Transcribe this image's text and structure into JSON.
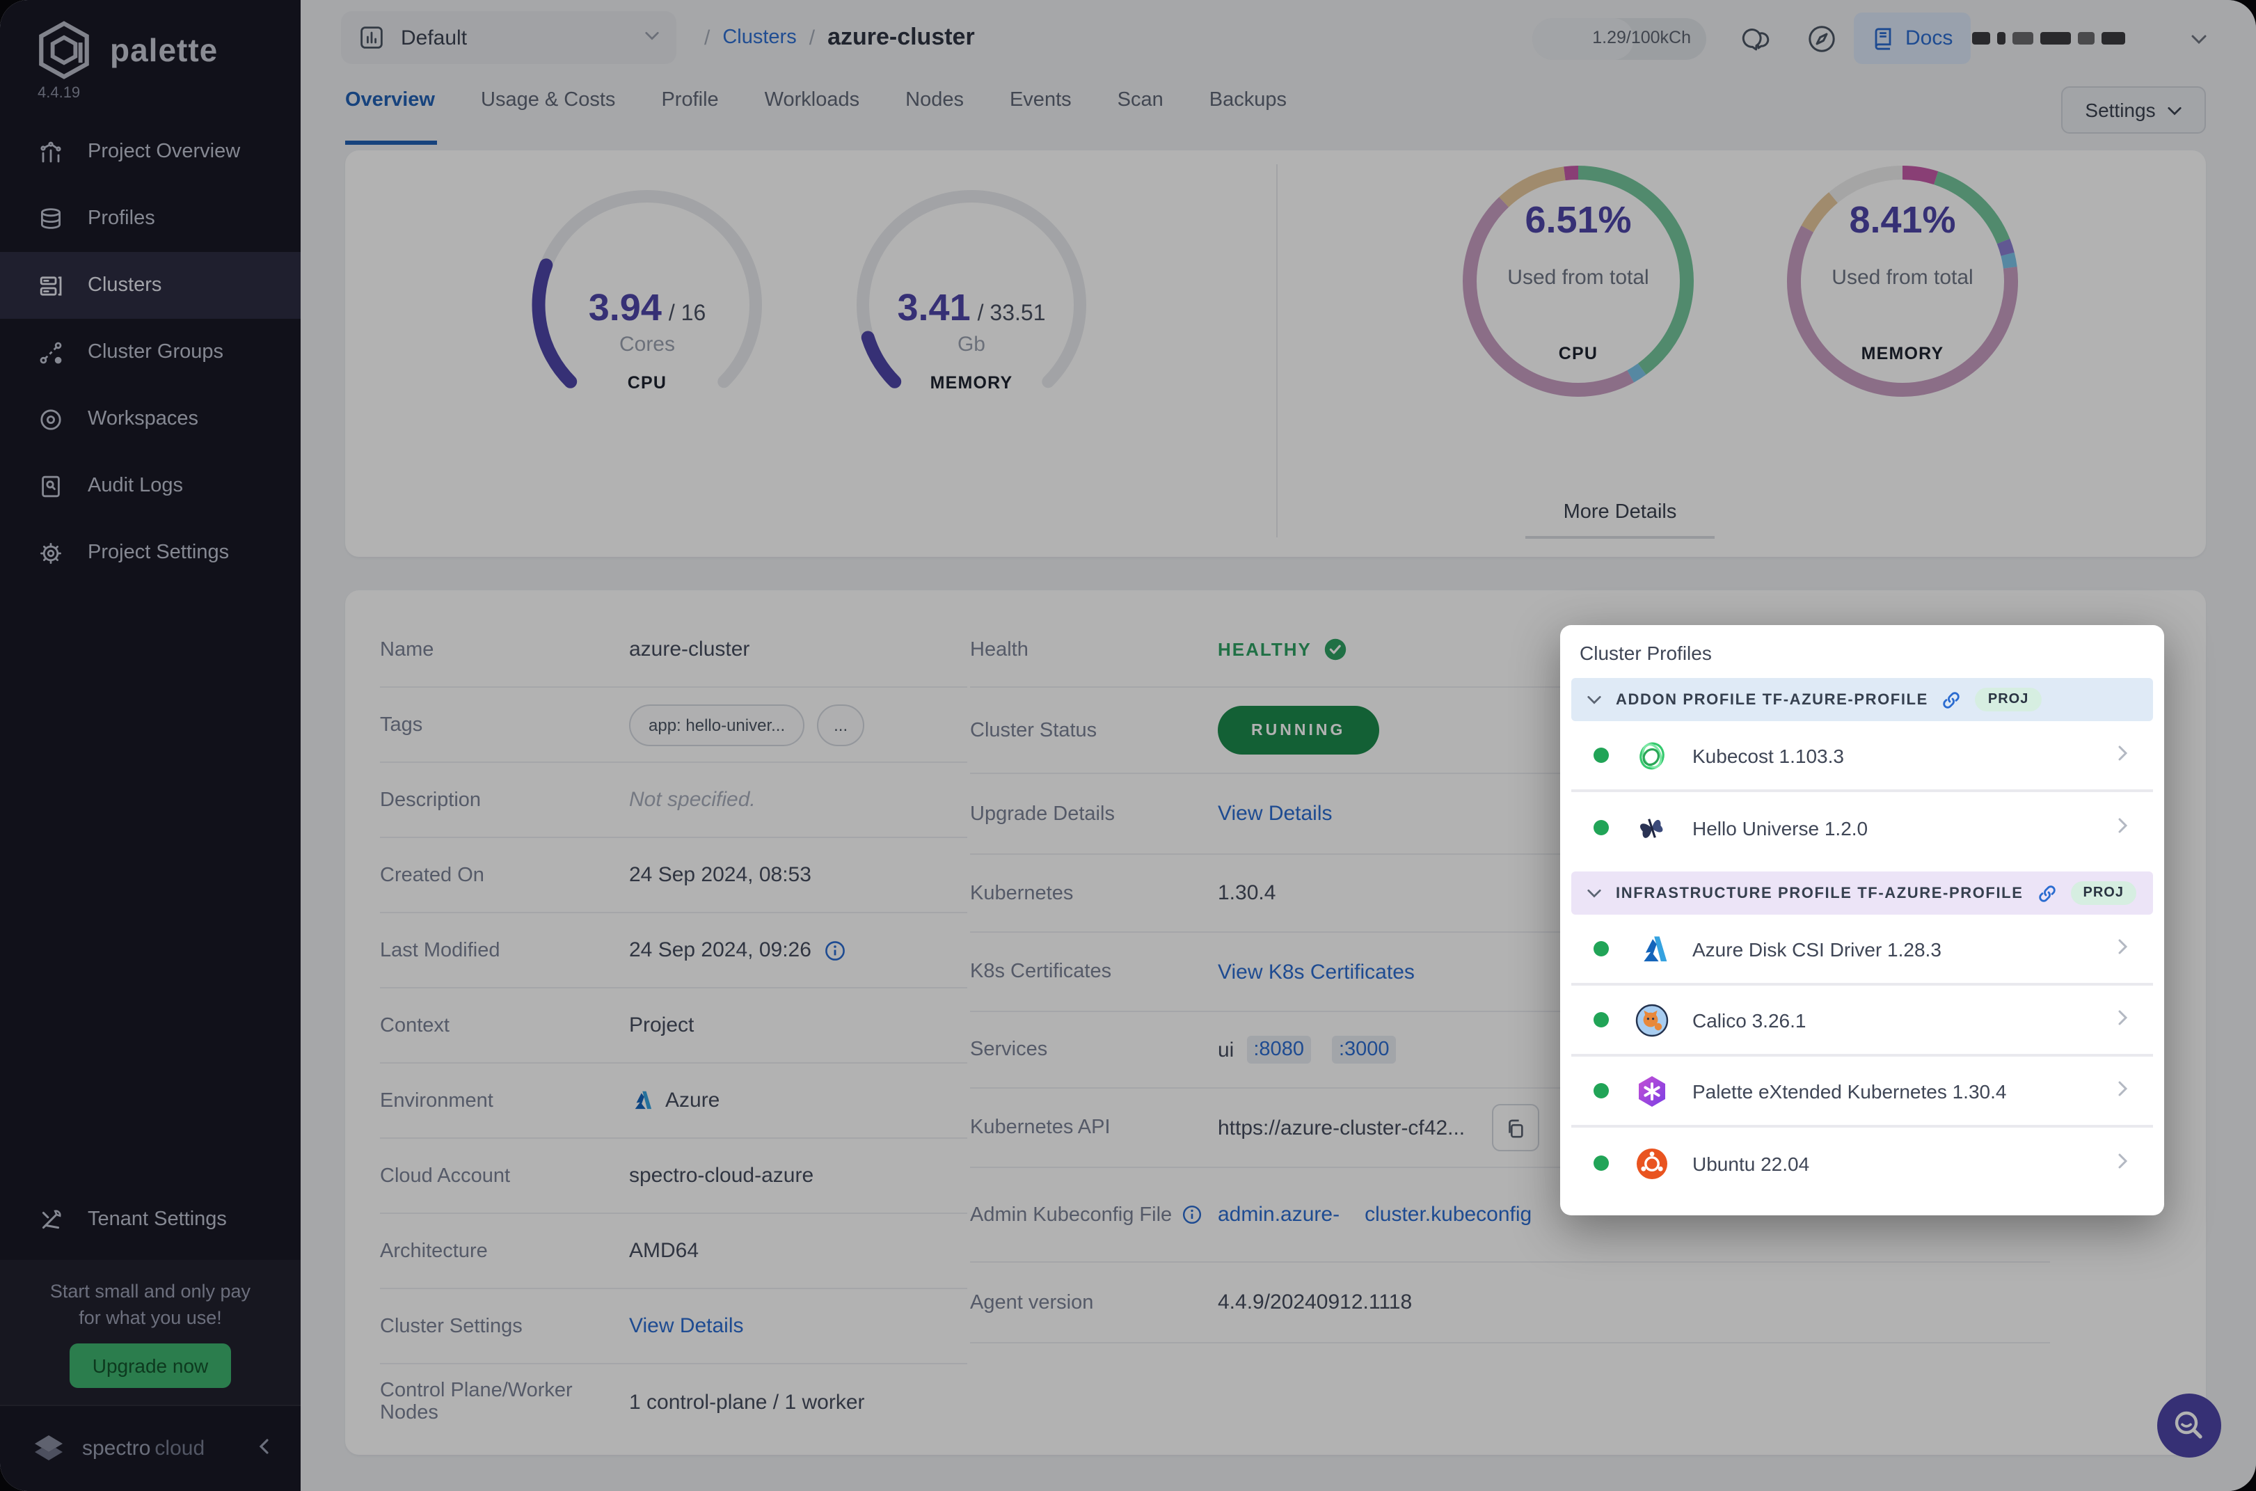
{
  "sidebar": {
    "logo_text": "palette",
    "version": "4.4.19",
    "items": [
      {
        "label": "Project Overview"
      },
      {
        "label": "Profiles"
      },
      {
        "label": "Clusters"
      },
      {
        "label": "Cluster Groups"
      },
      {
        "label": "Workspaces"
      },
      {
        "label": "Audit Logs"
      },
      {
        "label": "Project Settings"
      }
    ],
    "tenant_settings_label": "Tenant Settings",
    "promo": {
      "line1": "Start small and only pay",
      "line2": "for what you use!",
      "button": "Upgrade now"
    },
    "footer": {
      "brand_primary": "spectro",
      "brand_secondary": "cloud"
    }
  },
  "topbar": {
    "project_selector": "Default",
    "breadcrumb": {
      "sep1": "/",
      "parent": "Clusters",
      "sep2": "/",
      "current": "azure-cluster"
    },
    "usage_pill": "1.29/100kCh",
    "docs_label": "Docs"
  },
  "tabs": {
    "items": [
      {
        "label": "Overview"
      },
      {
        "label": "Usage & Costs"
      },
      {
        "label": "Profile"
      },
      {
        "label": "Workloads"
      },
      {
        "label": "Nodes"
      },
      {
        "label": "Events"
      },
      {
        "label": "Scan"
      },
      {
        "label": "Backups"
      }
    ],
    "settings_button": "Settings"
  },
  "metrics": {
    "more_details": "More Details"
  },
  "chart_data": [
    {
      "type": "gauge",
      "name": "cpu-usage",
      "value": 3.94,
      "total": 16,
      "value_str": "3.94",
      "total_str": "/ 16",
      "unit": "Cores",
      "label": "CPU",
      "color": "#4e46a8",
      "track": "#e8eaee",
      "start_deg": 225,
      "sweep_deg": 270
    },
    {
      "type": "gauge",
      "name": "memory-usage",
      "value": 3.41,
      "total": 33.51,
      "value_str": "3.41",
      "total_str": "/ 33.51",
      "unit": "Gb",
      "label": "MEMORY",
      "color": "#4e46a8",
      "track": "#e8eaee",
      "start_deg": 225,
      "sweep_deg": 270
    },
    {
      "type": "donut",
      "name": "cpu-used",
      "percent": "6.51%",
      "caption": "Used from total",
      "label": "CPU",
      "segments": [
        {
          "color": "#74c69d",
          "pct": 40
        },
        {
          "color": "#7cc3e8",
          "pct": 2
        },
        {
          "color": "#c79ec2",
          "pct": 46
        },
        {
          "color": "#e6c79c",
          "pct": 10
        },
        {
          "color": "#c45ba8",
          "pct": 2
        }
      ]
    },
    {
      "type": "donut",
      "name": "memory-used",
      "percent": "8.41%",
      "caption": "Used from total",
      "label": "MEMORY",
      "segments": [
        {
          "color": "#c45ba8",
          "pct": 5
        },
        {
          "color": "#74c69d",
          "pct": 14
        },
        {
          "color": "#8b7fd1",
          "pct": 2
        },
        {
          "color": "#7cc3e8",
          "pct": 2
        },
        {
          "color": "#c79ec2",
          "pct": 60
        },
        {
          "color": "#e6c79c",
          "pct": 6
        },
        {
          "color": "#ededed",
          "pct": 11
        }
      ]
    }
  ],
  "details": {
    "left": [
      {
        "label": "Name",
        "value": "azure-cluster"
      },
      {
        "label": "Tags",
        "chip1": "app: hello-univer...",
        "chip2": "..."
      },
      {
        "label": "Description",
        "value": "Not specified."
      },
      {
        "label": "Created On",
        "value": "24 Sep 2024, 08:53"
      },
      {
        "label": "Last Modified",
        "value": "24 Sep 2024, 09:26"
      },
      {
        "label": "Context",
        "value": "Project"
      },
      {
        "label": "Environment",
        "value": "Azure"
      },
      {
        "label": "Cloud Account",
        "value": "spectro-cloud-azure"
      },
      {
        "label": "Architecture",
        "value": "AMD64"
      },
      {
        "label": "Cluster Settings",
        "value": "View Details"
      },
      {
        "label": "Control Plane/Worker Nodes",
        "value": "1 control-plane / 1 worker"
      }
    ],
    "right": [
      {
        "label": "Health",
        "value": "HEALTHY"
      },
      {
        "label": "Cluster Status",
        "value": "RUNNING"
      },
      {
        "label": "Upgrade Details",
        "value": "View Details"
      },
      {
        "label": "Kubernetes",
        "value": "1.30.4"
      },
      {
        "label": "K8s Certificates",
        "value": "View K8s Certificates"
      },
      {
        "label": "Services",
        "prefix": "ui",
        "port1": ":8080",
        "port2": ":3000"
      },
      {
        "label": "Kubernetes API",
        "value": "https://azure-cluster-cf42..."
      },
      {
        "label": "Admin Kubeconfig File",
        "line1": "admin.azure-",
        "line2": "cluster.kubeconfig"
      },
      {
        "label": "Agent version",
        "value": "4.4.9/20240912.1118"
      }
    ]
  },
  "profiles_panel": {
    "title": "Cluster Profiles",
    "sections": [
      {
        "header": "ADDON PROFILE TF-AZURE-PROFILE",
        "badge": "PROJ",
        "items": [
          {
            "name": "Kubecost 1.103.3"
          },
          {
            "name": "Hello Universe 1.2.0"
          }
        ]
      },
      {
        "header": "INFRASTRUCTURE PROFILE TF-AZURE-PROFILE",
        "badge": "PROJ",
        "items": [
          {
            "name": "Azure Disk CSI Driver 1.28.3"
          },
          {
            "name": "Calico 3.26.1"
          },
          {
            "name": "Palette eXtended Kubernetes 1.30.4"
          },
          {
            "name": "Ubuntu 22.04"
          }
        ]
      }
    ]
  }
}
